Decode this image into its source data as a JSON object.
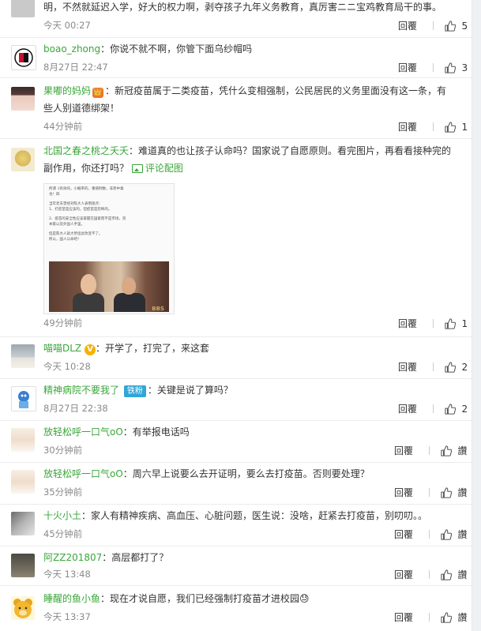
{
  "labels": {
    "reply": "回覆",
    "like_zero": "讚"
  },
  "comments": [
    {
      "id": "c0",
      "text": "明，不然就延迟入学，好大的权力啊，剥夺孩子九年义务教育，真厉害ニニ宝鸡教育局干的事。",
      "time": "今天 00:27",
      "likes": "5"
    },
    {
      "id": "c1",
      "username": "boao_zhong",
      "text": "：你说不就不啊，你管下面乌纱帽吗",
      "time": "8月27日 22:47",
      "likes": "3"
    },
    {
      "id": "c2",
      "username": "果嘟的妈妈",
      "text": "：新冠疫苗属于二类疫苗，凭什么变相强制，公民居民的义务里面没有这一条，有些人别道德绑架！",
      "time": "44分钟前",
      "likes": "1"
    },
    {
      "id": "c3",
      "username": "北国之春之桃之夭夭",
      "text": "：难道真的也让孩子认命吗？国家说了自愿原则。看完图片，再看看接种完的副作用，你还打吗？",
      "view_pic": "评论配图",
      "time": "49分钟前",
      "likes": "1",
      "attachment": {
        "lines": [
          "所谓《有效的，小概率的，重病例数，非甚中毒",
          "也！四",
          "",
          "当年老夫曾经对陈大人表明观点：",
          "1、打疫苗是应该的，但疫苗是恐怖的。",
          "",
          "2、疫苗的安全性应该掌握在国家而不是市场，资",
          "本家以及外国人手里。",
          "",
          "但是陈大人就大势坦此改变不了。",
          "所以，国人认命吧！"
        ],
        "watermark": "BBS"
      }
    },
    {
      "id": "c4",
      "username": "喵喵DLZ",
      "badge": "V",
      "text": "：开学了，打完了，来这套",
      "time": "今天 10:28",
      "likes": "2"
    },
    {
      "id": "c5",
      "username": "精神病院不要我了",
      "fan_badge": "铁粉",
      "text": "：关键是说了算吗？",
      "time": "8月27日 22:38",
      "likes": "2"
    },
    {
      "id": "c6",
      "username": "放轻松呼一口气oO",
      "text": "：有举报电话吗",
      "time": "30分钟前",
      "likes": ""
    },
    {
      "id": "c7",
      "username": "放轻松呼一口气oO",
      "text": "：周六早上说要么去开证明，要么去打疫苗。否则要处理？",
      "time": "35分钟前",
      "likes": ""
    },
    {
      "id": "c8",
      "username": "十火小土",
      "text": "：家人有精神疾病、高血压、心脏问题，医生说：没啥，赶紧去打疫苗，别叨叨。。",
      "time": "45分钟前",
      "likes": ""
    },
    {
      "id": "c9",
      "username": "阿ZZ201807",
      "text": "：高层都打了？",
      "time": "今天 13:48",
      "likes": ""
    },
    {
      "id": "c10",
      "username": "睡醒的鱼小鱼",
      "text": "：现在才说自愿，我们已经强制打疫苗才进校园",
      "emoji": "😓",
      "time": "今天 13:37",
      "likes": ""
    }
  ]
}
